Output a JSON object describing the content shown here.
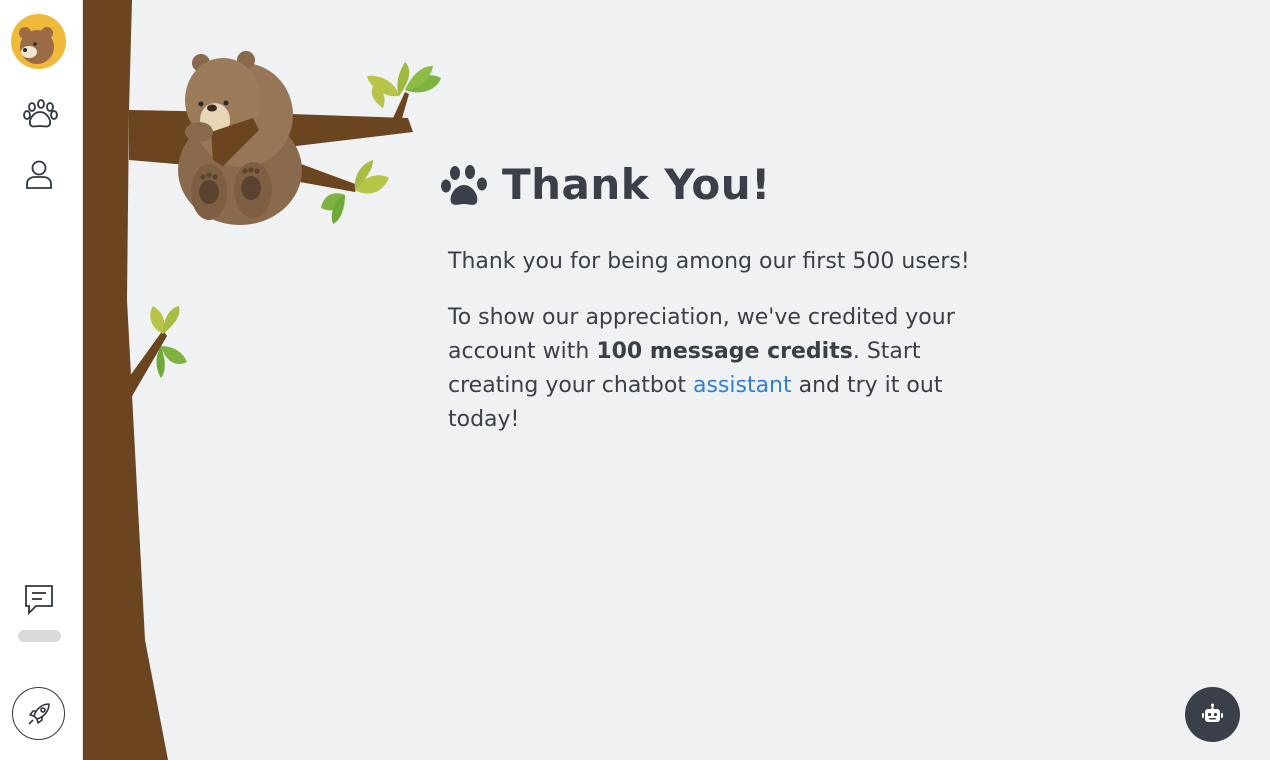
{
  "sidebar": {
    "avatar_icon": "bear-avatar-icon",
    "nav": [
      {
        "icon": "paw-icon"
      },
      {
        "icon": "user-icon"
      },
      {
        "icon": "message-icon"
      },
      {
        "icon": "rocket-icon"
      }
    ]
  },
  "main": {
    "title": "Thank You!",
    "title_icon": "paw-icon",
    "paragraph1": "Thank you for being among our first 500 users!",
    "paragraph2": {
      "part1": "To show our appreciation, we've credited your account with ",
      "bold": "100 message credits",
      "part2": ". Start creating your chatbot ",
      "link": "assistant",
      "part3": " and try it out today!"
    }
  },
  "chat_widget": {
    "icon": "robot-icon"
  },
  "colors": {
    "background": "#f0f1f3",
    "text": "#3a4049",
    "link": "#2f7fd6",
    "tree": "#6b4420",
    "avatar_bg": "#f0b93a"
  }
}
